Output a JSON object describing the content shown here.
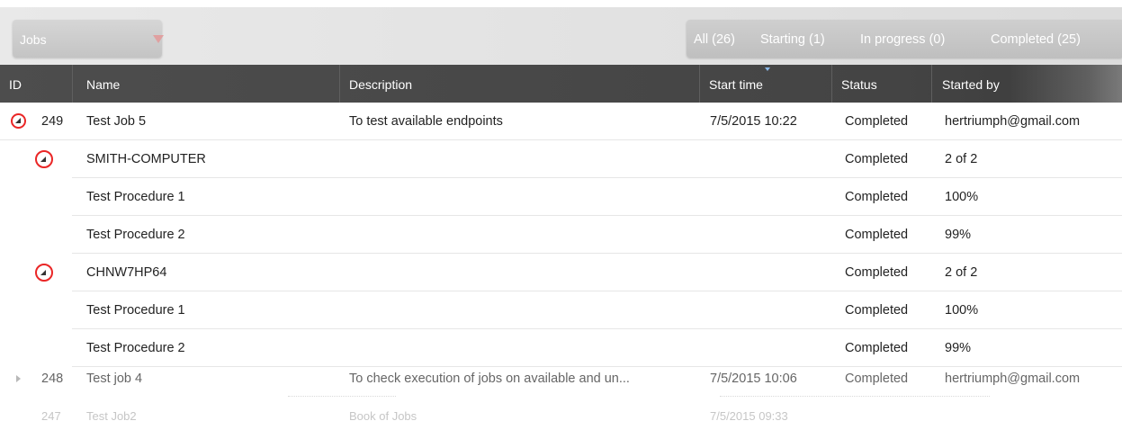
{
  "toolbar": {
    "view_select": {
      "value": "Jobs"
    },
    "filters": [
      {
        "label": "All (26)"
      },
      {
        "label": "Starting (1)"
      },
      {
        "label": "In progress (0)"
      },
      {
        "label": "Completed (25)"
      }
    ]
  },
  "table": {
    "columns": [
      "ID",
      "Name",
      "Description",
      "Start time",
      "Status",
      "Started by"
    ],
    "sorted_column": "Start time",
    "rows": [
      {
        "kind": "job",
        "expanded": true,
        "id": "249",
        "name": "Test Job 5",
        "description": "To test available endpoints",
        "start_time": "7/5/2015 10:22",
        "status": "Completed",
        "started_by": "hertriumph@gmail.com"
      },
      {
        "kind": "endpoint",
        "expanded": true,
        "name": "SMITH-COMPUTER",
        "status": "Completed",
        "started_by": "2 of 2"
      },
      {
        "kind": "procedure",
        "name": "Test Procedure 1",
        "status": "Completed",
        "started_by": "100%"
      },
      {
        "kind": "procedure",
        "name": "Test Procedure 2",
        "status": "Completed",
        "started_by": "99%"
      },
      {
        "kind": "endpoint",
        "expanded": true,
        "name": "CHNW7HP64",
        "status": "Completed",
        "started_by": "2 of 2"
      },
      {
        "kind": "procedure",
        "name": "Test Procedure 1",
        "status": "Completed",
        "started_by": "100%"
      },
      {
        "kind": "procedure",
        "name": "Test Procedure 2",
        "status": "Completed",
        "started_by": "99%"
      },
      {
        "kind": "job",
        "expanded": false,
        "id": "248",
        "name": "Test job 4",
        "description": "To check execution of jobs on available and un...",
        "start_time": "7/5/2015 10:06",
        "status": "Completed",
        "started_by": "hertriumph@gmail.com"
      },
      {
        "kind": "job",
        "expanded": false,
        "id": "247",
        "name": "Test Job2",
        "description": "Book of Jobs",
        "start_time": "7/5/2015 09:33",
        "status": "",
        "started_by": ""
      }
    ]
  },
  "colors": {
    "header_bg": "#444444",
    "highlight_ring": "#ea2626",
    "toolbar_bg": "#e2e2e2"
  }
}
